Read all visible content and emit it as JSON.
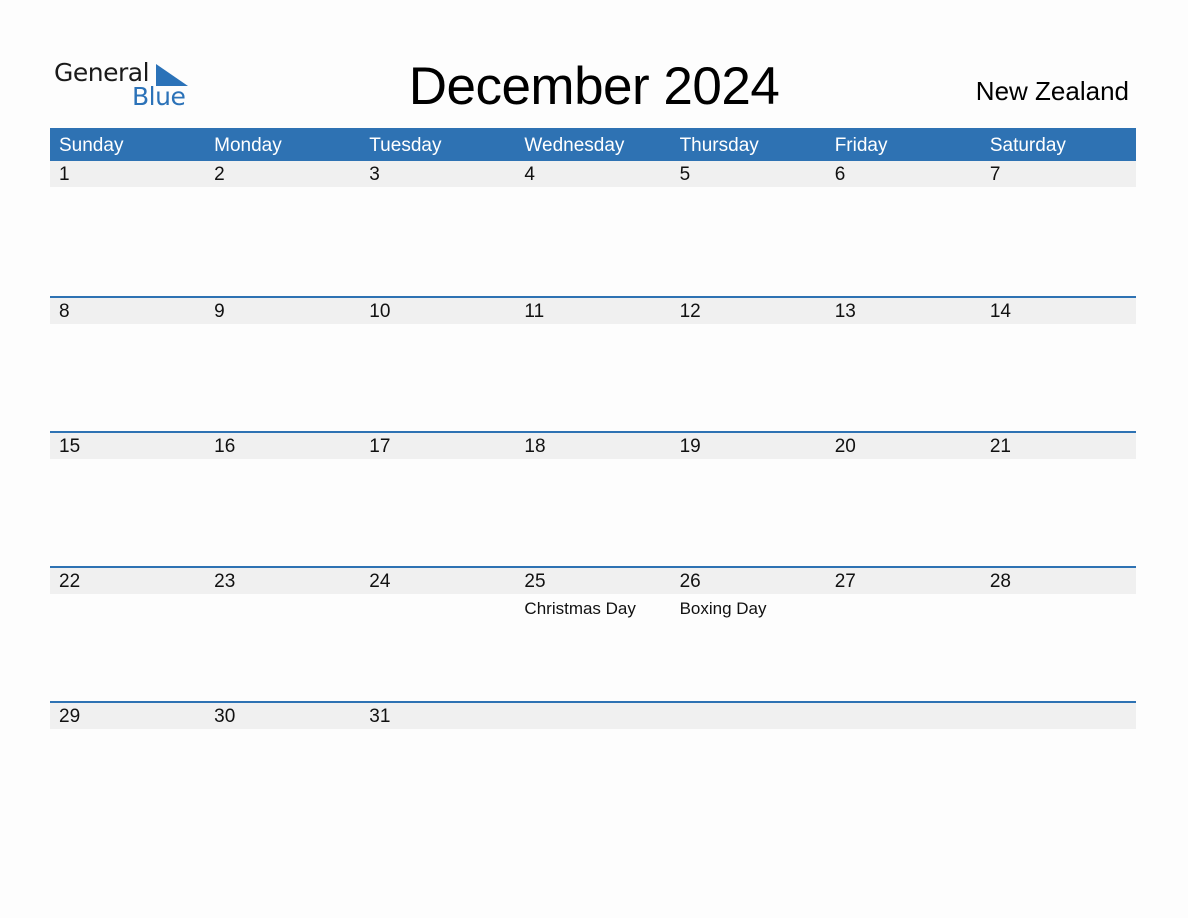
{
  "logo": {
    "line1": "General",
    "line2": "Blue",
    "icon": "triangle-flag-icon",
    "brand_color": "#2b72b8"
  },
  "header": {
    "title": "December 2024",
    "country": "New Zealand"
  },
  "colors": {
    "accent": "#2e72b3",
    "band": "#f0f0f0"
  },
  "weekdays": [
    "Sunday",
    "Monday",
    "Tuesday",
    "Wednesday",
    "Thursday",
    "Friday",
    "Saturday"
  ],
  "weeks": [
    [
      {
        "day": "1",
        "event": ""
      },
      {
        "day": "2",
        "event": ""
      },
      {
        "day": "3",
        "event": ""
      },
      {
        "day": "4",
        "event": ""
      },
      {
        "day": "5",
        "event": ""
      },
      {
        "day": "6",
        "event": ""
      },
      {
        "day": "7",
        "event": ""
      }
    ],
    [
      {
        "day": "8",
        "event": ""
      },
      {
        "day": "9",
        "event": ""
      },
      {
        "day": "10",
        "event": ""
      },
      {
        "day": "11",
        "event": ""
      },
      {
        "day": "12",
        "event": ""
      },
      {
        "day": "13",
        "event": ""
      },
      {
        "day": "14",
        "event": ""
      }
    ],
    [
      {
        "day": "15",
        "event": ""
      },
      {
        "day": "16",
        "event": ""
      },
      {
        "day": "17",
        "event": ""
      },
      {
        "day": "18",
        "event": ""
      },
      {
        "day": "19",
        "event": ""
      },
      {
        "day": "20",
        "event": ""
      },
      {
        "day": "21",
        "event": ""
      }
    ],
    [
      {
        "day": "22",
        "event": ""
      },
      {
        "day": "23",
        "event": ""
      },
      {
        "day": "24",
        "event": ""
      },
      {
        "day": "25",
        "event": "Christmas Day"
      },
      {
        "day": "26",
        "event": "Boxing Day"
      },
      {
        "day": "27",
        "event": ""
      },
      {
        "day": "28",
        "event": ""
      }
    ],
    [
      {
        "day": "29",
        "event": ""
      },
      {
        "day": "30",
        "event": ""
      },
      {
        "day": "31",
        "event": ""
      },
      {
        "day": "",
        "event": ""
      },
      {
        "day": "",
        "event": ""
      },
      {
        "day": "",
        "event": ""
      },
      {
        "day": "",
        "event": ""
      }
    ]
  ]
}
